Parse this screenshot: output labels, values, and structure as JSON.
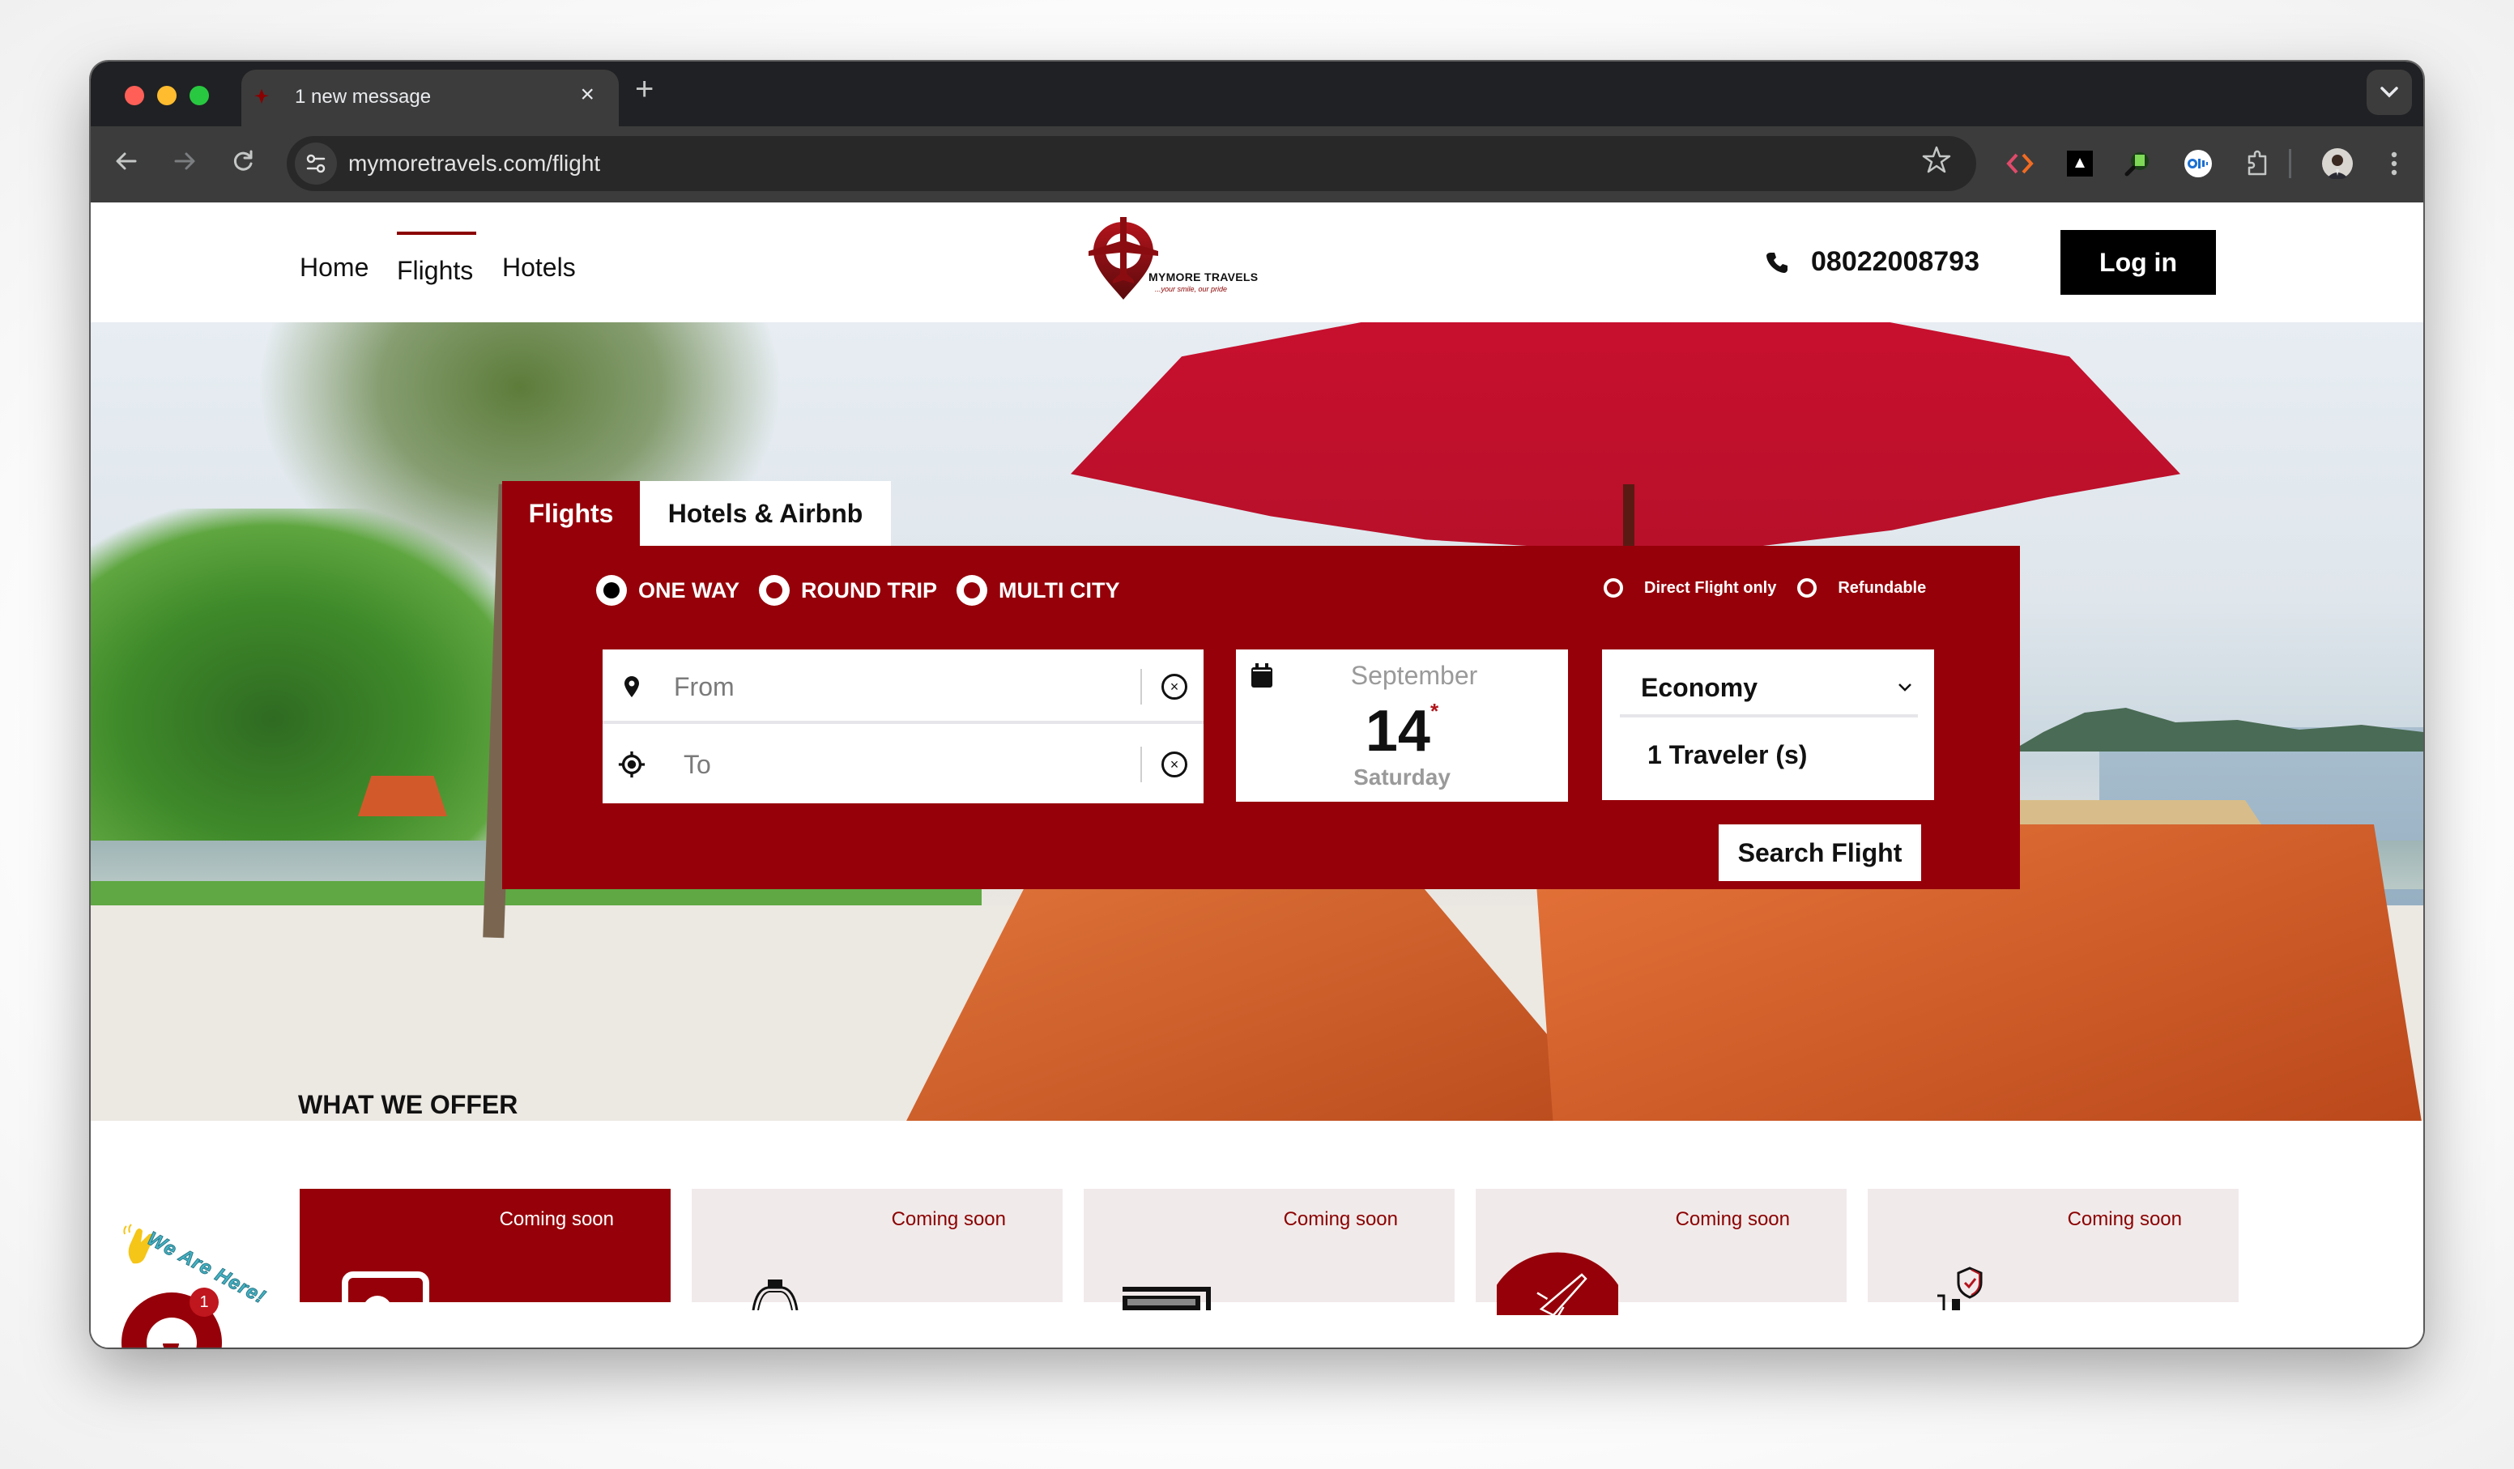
{
  "browser": {
    "tab_title": "1 new message",
    "tab_close": "×",
    "new_tab": "+",
    "url": "mymoretravels.com/flight",
    "icons": {
      "back": "arrow-left-icon",
      "forward": "arrow-right-icon",
      "reload": "reload-icon",
      "site_info": "tune-icon",
      "bookmark": "star-icon",
      "extensions": [
        "code-brackets-extension-icon",
        "triangle-extension-icon",
        "search-f-extension-icon",
        "otter-extension-icon",
        "puzzle-extensions-icon"
      ],
      "profile": "avatar",
      "menu": "kebab-menu-icon",
      "tab_list": "chevron-down-icon"
    }
  },
  "site": {
    "nav": [
      {
        "label": "Home",
        "active": false
      },
      {
        "label": "Flights",
        "active": true
      },
      {
        "label": "Hotels",
        "active": false
      }
    ],
    "logo": {
      "name": "MYMORE TRAVELS",
      "tagline": "...your smile, our pride"
    },
    "phone": "08022008793",
    "login_label": "Log in",
    "brand_color": "#960009"
  },
  "search": {
    "tabs": [
      {
        "label": "Flights",
        "active": true
      },
      {
        "label": "Hotels & Airbnb",
        "active": false
      }
    ],
    "trip_types": [
      {
        "label": "ONE WAY",
        "checked": true
      },
      {
        "label": "ROUND TRIP",
        "checked": false
      },
      {
        "label": "MULTI CITY",
        "checked": false
      }
    ],
    "filters": [
      {
        "label": "Direct Flight only",
        "checked": false
      },
      {
        "label": "Refundable",
        "checked": false
      }
    ],
    "from": {
      "placeholder": "From",
      "value": ""
    },
    "to": {
      "placeholder": "To",
      "value": ""
    },
    "clear_symbol": "×",
    "date": {
      "month": "September",
      "day": "14",
      "required_marker": "*",
      "weekday": "Saturday"
    },
    "cabin_class": "Economy",
    "travelers": "1 Traveler (s)",
    "submit_label": "Search Flight"
  },
  "offers": {
    "title": "WHAT WE OFFER",
    "cards": [
      {
        "label": "Coming soon",
        "icon": "hotel-bed-icon",
        "active": true
      },
      {
        "label": "Coming soon",
        "icon": "car-icon",
        "active": false
      },
      {
        "label": "Coming soon",
        "icon": "card-icon",
        "active": false
      },
      {
        "label": "Coming soon",
        "icon": "airplane-icon",
        "active": false
      },
      {
        "label": "Coming soon",
        "icon": "insurance-shield-icon",
        "active": false
      }
    ]
  },
  "chat": {
    "caption": "We Are Here!",
    "badge_count": "1"
  }
}
